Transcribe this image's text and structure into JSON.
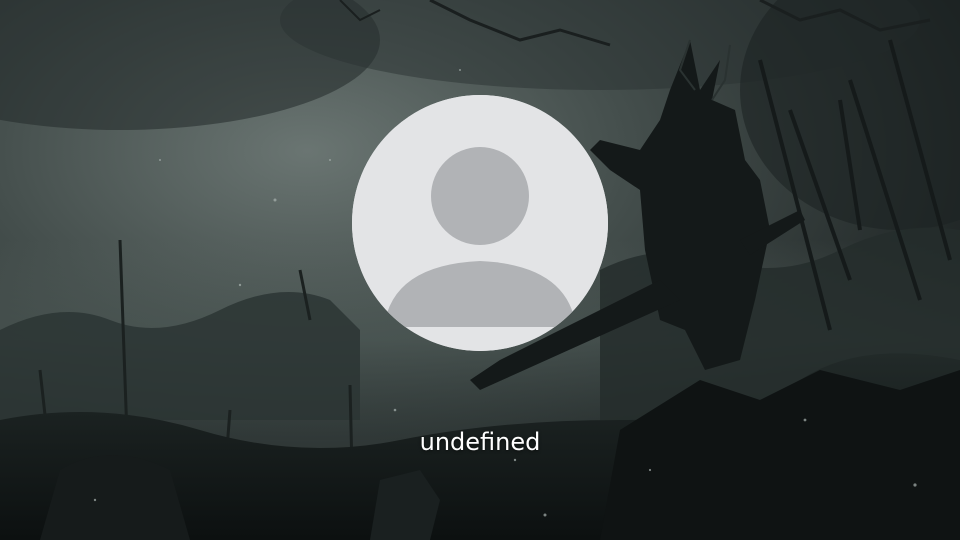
{
  "lock_screen": {
    "wallpaper": {
      "sky_color": "#3c4544",
      "mist_color": "#56625e",
      "ground_color": "#151a1a",
      "silhouette_color": "#0f1313"
    },
    "user": {
      "avatar_icon": "default-user-icon",
      "avatar_background": "#e3e4e6",
      "avatar_figure_color": "#b1b3b6",
      "name": "undefined"
    }
  }
}
